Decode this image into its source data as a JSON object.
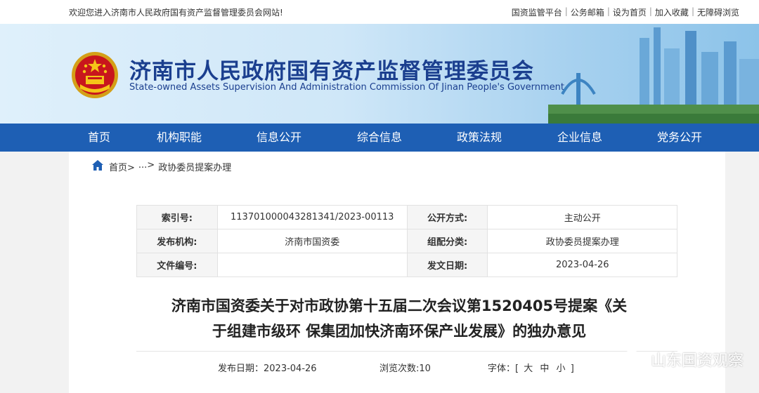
{
  "topbar": {
    "welcome": "欢迎您进入济南市人民政府国有资产监督管理委员会网站!",
    "links": [
      "国资监管平台",
      "公务邮箱",
      "设为首页",
      "加入收藏",
      "无障碍浏览"
    ],
    "separator": "|"
  },
  "banner": {
    "title": "济南市人民政府国有资产监督管理委员会",
    "subtitle": "State-owned Assets Supervision And Administration Commission Of Jinan People's Government"
  },
  "nav": {
    "items": [
      "首页",
      "机构职能",
      "信息公开",
      "综合信息",
      "政策法规",
      "企业信息",
      "党务公开"
    ]
  },
  "breadcrumb": {
    "home": "首页>",
    "ellipsis": "...>",
    "current": "政协委员提案办理"
  },
  "meta": {
    "index_label": "索引号:",
    "index_value": "113701000043281341/2023-00113",
    "open_label": "公开方式:",
    "open_value": "主动公开",
    "publisher_label": "发布机构:",
    "publisher_value": "济南市国资委",
    "category_label": "组配分类:",
    "category_value": "政协委员提案办理",
    "docno_label": "文件编号:",
    "docno_value": "",
    "date_label": "发文日期:",
    "date_value": "2023-04-26"
  },
  "article": {
    "title_line1": "济南市国资委关于对市政协第十五届二次会议第1520405号提案《关",
    "title_line2": "于组建市级环 保集团加快济南环保产业发展》的独办意见",
    "publish_date": "发布日期：2023-04-26",
    "views": "浏览次数:10",
    "font_label": "字体：[",
    "font_large": "大",
    "font_medium": "中",
    "font_small": "小",
    "font_close": "]"
  },
  "watermark": "山东国资观察",
  "colors": {
    "nav_bg": "#1e5fb4",
    "title_blue": "#1b3f8f"
  }
}
